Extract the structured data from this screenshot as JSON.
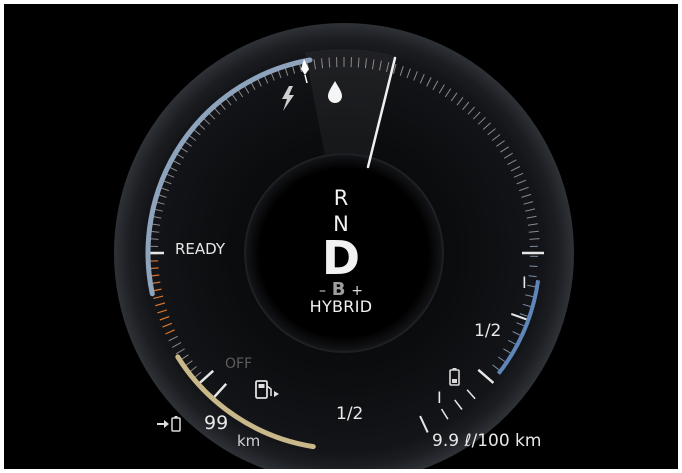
{
  "drive": {
    "gears": [
      "R",
      "N",
      "D"
    ],
    "selected_gear": "D",
    "b_selector": {
      "minus": "–",
      "label": "B",
      "plus": "+"
    },
    "mode": "HYBRID"
  },
  "power_gauge": {
    "ready_label": "READY",
    "off_label": "OFF",
    "electric_icon": "lightning-icon",
    "fuel_drop_icon": "drop-icon"
  },
  "battery_gauge": {
    "full_label": "I",
    "half_label": "1/2",
    "empty_label": "I",
    "icon": "battery-icon",
    "color": "#5f86b8"
  },
  "fuel_gauge": {
    "half_label": "1/2",
    "icon": "fuel-pump-icon",
    "color": "#c8b88a"
  },
  "electric_range": {
    "icon": "arrow-battery-icon",
    "value": "99",
    "unit": "km"
  },
  "consumption": {
    "value": "9.9",
    "unit": "ℓ/100 km"
  },
  "colors": {
    "background": "#000000",
    "power_arc": "#8ea4bd",
    "charge_ticks": "#d9762d",
    "needle": "#f0f0f0"
  }
}
